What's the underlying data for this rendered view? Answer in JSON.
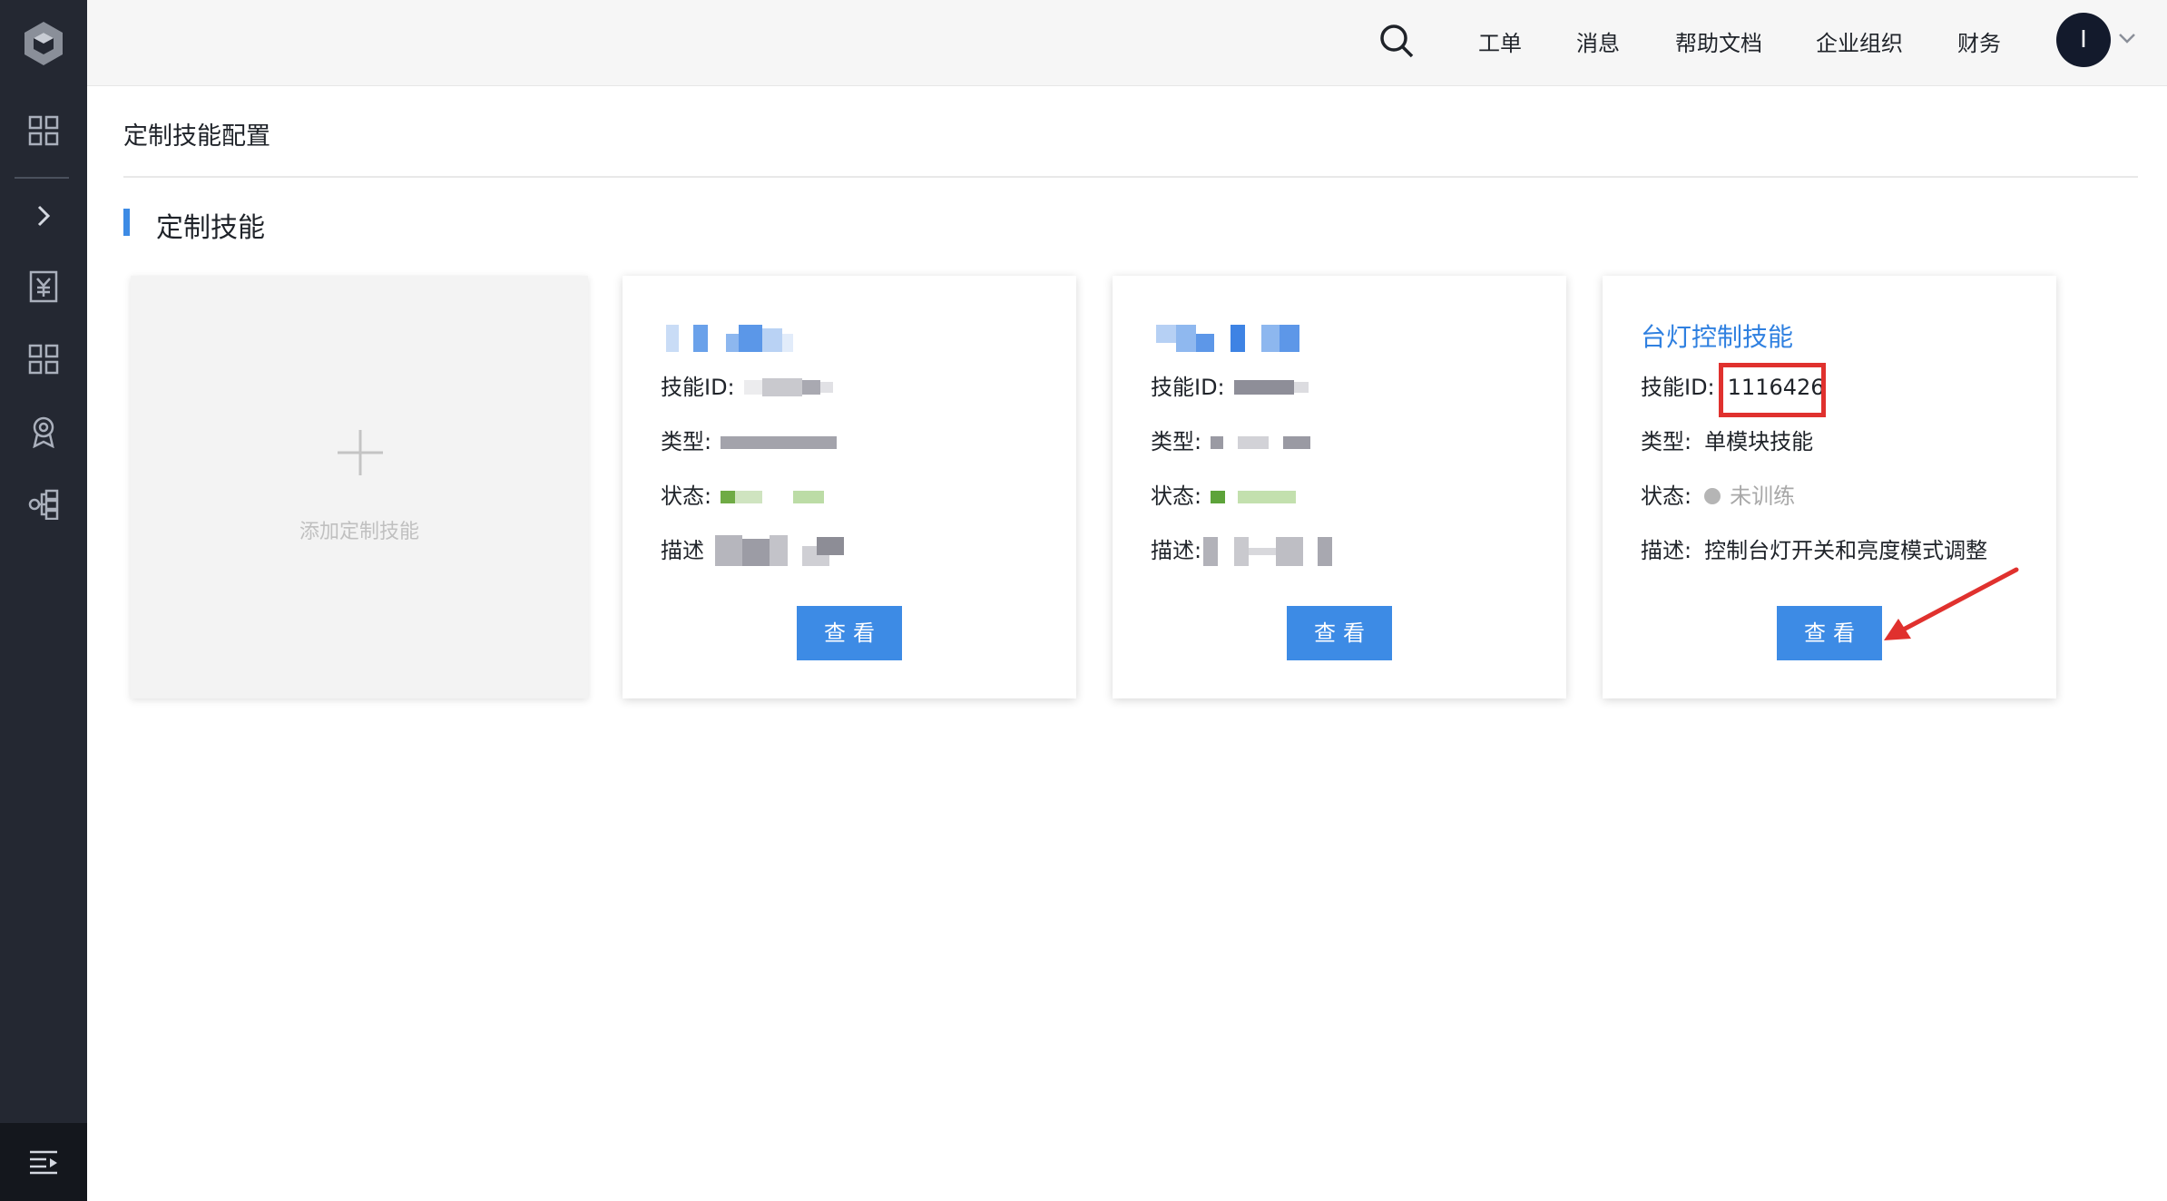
{
  "sidebar": {
    "items": [
      {
        "icon": "dashboard-grid-icon"
      },
      {
        "icon": "expand-chevron-icon"
      },
      {
        "icon": "billing-yuan-icon"
      },
      {
        "icon": "apps-grid-icon"
      },
      {
        "icon": "award-badge-icon"
      },
      {
        "icon": "workflow-icon"
      }
    ],
    "collapse_icon": "menu-collapse-icon"
  },
  "header": {
    "search_icon": "search-icon",
    "links": [
      "工单",
      "消息",
      "帮助文档",
      "企业组织",
      "财务"
    ],
    "avatar_letter": "I"
  },
  "page": {
    "title": "定制技能配置",
    "section_title": "定制技能"
  },
  "add_card": {
    "label": "添加定制技能"
  },
  "cards": [
    {
      "title": "",
      "id_label": "技能ID:",
      "id_value": "",
      "type_label": "类型:",
      "type_value": "",
      "status_label": "状态:",
      "status_value": "",
      "desc_label": "描述",
      "desc_value": "",
      "button": "查看"
    },
    {
      "title": "",
      "id_label": "技能ID:",
      "id_value": "",
      "type_label": "类型:",
      "type_value": "",
      "status_label": "状态:",
      "status_value": "",
      "desc_label": "描述:",
      "desc_value": "",
      "button": "查看"
    },
    {
      "title": "台灯控制技能",
      "id_label": "技能ID:",
      "id_value": "1116426",
      "type_label": "类型:",
      "type_value": "单模块技能",
      "status_label": "状态:",
      "status_value": "未训练",
      "desc_label": "描述:",
      "desc_value": "控制台灯开关和亮度模式调整",
      "button": "查看"
    }
  ],
  "colors": {
    "accent": "#3d8be5",
    "title_blue": "#2f80e0",
    "highlight_red": "#e0312e",
    "sidebar_bg": "#242832"
  }
}
